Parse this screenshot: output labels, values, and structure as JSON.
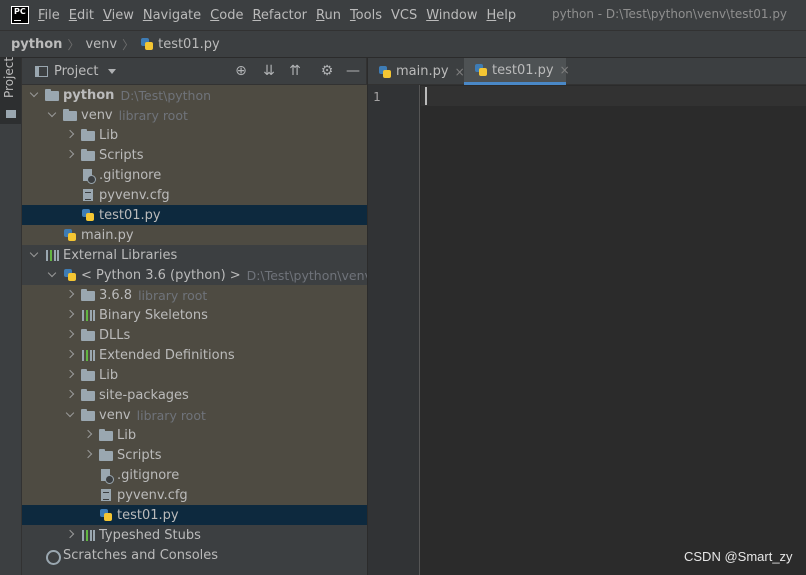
{
  "app": {
    "logo_text": "PC",
    "window_title": "python - D:\\Test\\python\\venv\\test01.py"
  },
  "menu": [
    {
      "mnemonic": "F",
      "rest": "ile"
    },
    {
      "mnemonic": "E",
      "rest": "dit"
    },
    {
      "mnemonic": "V",
      "rest": "iew"
    },
    {
      "mnemonic": "N",
      "rest": "avigate"
    },
    {
      "mnemonic": "C",
      "rest": "ode"
    },
    {
      "mnemonic": "R",
      "rest": "efactor"
    },
    {
      "mnemonic": "R",
      "rest": "un"
    },
    {
      "mnemonic": "T",
      "rest": "ools"
    },
    {
      "mnemonic": "",
      "rest": "VCS"
    },
    {
      "mnemonic": "W",
      "rest": "indow"
    },
    {
      "mnemonic": "H",
      "rest": "elp"
    }
  ],
  "breadcrumb": [
    "python",
    "venv",
    "test01.py"
  ],
  "toolstrip": {
    "project_tab": "Project"
  },
  "project_panel": {
    "title": "Project",
    "icons": [
      "locate-icon",
      "expand-all-icon",
      "collapse-all-icon",
      "gear-icon",
      "minimize-icon"
    ]
  },
  "tree": [
    {
      "label": "python",
      "sub": "D:\\Test\\python",
      "bold": true,
      "arrow": "down",
      "icon": "folder-icon",
      "indent": 0
    },
    {
      "label": "venv",
      "sub": "library root",
      "arrow": "down",
      "icon": "folder-icon",
      "indent": 1
    },
    {
      "label": "Lib",
      "sub": "",
      "arrow": "right",
      "icon": "folder-icon",
      "indent": 2
    },
    {
      "label": "Scripts",
      "sub": "",
      "arrow": "right",
      "icon": "folder-icon",
      "indent": 2
    },
    {
      "label": ".gitignore",
      "sub": "",
      "arrow": "none",
      "icon": "gitignore-icon",
      "indent": 2
    },
    {
      "label": "pyvenv.cfg",
      "sub": "",
      "arrow": "none",
      "icon": "file-icon",
      "indent": 2
    },
    {
      "label": "test01.py",
      "sub": "",
      "arrow": "none",
      "icon": "python-file-icon",
      "indent": 2,
      "selected": true
    },
    {
      "label": "main.py",
      "sub": "",
      "arrow": "none",
      "icon": "python-file-icon",
      "indent": 1
    },
    {
      "label": "External Libraries",
      "sub": "",
      "arrow": "down",
      "icon": "library-icon",
      "indent": 0
    },
    {
      "label": "< Python 3.6 (python) >",
      "sub": "D:\\Test\\python\\venv\\Scr",
      "arrow": "down",
      "icon": "python-file-icon",
      "indent": 1
    },
    {
      "label": "3.6.8",
      "sub": "library root",
      "arrow": "right",
      "icon": "folder-icon",
      "indent": 2
    },
    {
      "label": "Binary Skeletons",
      "sub": "",
      "arrow": "right",
      "icon": "library-icon",
      "indent": 2
    },
    {
      "label": "DLLs",
      "sub": "",
      "arrow": "right",
      "icon": "folder-icon",
      "indent": 2
    },
    {
      "label": "Extended Definitions",
      "sub": "",
      "arrow": "right",
      "icon": "library-icon",
      "indent": 2
    },
    {
      "label": "Lib",
      "sub": "",
      "arrow": "right",
      "icon": "folder-icon",
      "indent": 2
    },
    {
      "label": "site-packages",
      "sub": "",
      "arrow": "right",
      "icon": "folder-icon",
      "indent": 2
    },
    {
      "label": "venv",
      "sub": "library root",
      "arrow": "down",
      "icon": "folder-icon",
      "indent": 2
    },
    {
      "label": "Lib",
      "sub": "",
      "arrow": "right",
      "icon": "folder-icon",
      "indent": 3
    },
    {
      "label": "Scripts",
      "sub": "",
      "arrow": "right",
      "icon": "folder-icon",
      "indent": 3
    },
    {
      "label": ".gitignore",
      "sub": "",
      "arrow": "none",
      "icon": "gitignore-icon",
      "indent": 3
    },
    {
      "label": "pyvenv.cfg",
      "sub": "",
      "arrow": "none",
      "icon": "file-icon",
      "indent": 3
    },
    {
      "label": "test01.py",
      "sub": "",
      "arrow": "none",
      "icon": "python-file-icon",
      "indent": 3,
      "selected": true
    },
    {
      "label": "Typeshed Stubs",
      "sub": "",
      "arrow": "right",
      "icon": "library-icon",
      "indent": 2
    },
    {
      "label": "Scratches and Consoles",
      "sub": "",
      "arrow": "none",
      "icon": "scratches-icon",
      "indent": 0
    }
  ],
  "editor": {
    "tabs": [
      {
        "label": "main.py",
        "close": "×",
        "active": false
      },
      {
        "label": "test01.py",
        "close": "×",
        "active": true
      }
    ],
    "line_numbers": [
      "1"
    ]
  },
  "watermark": "CSDN @Smart_zy",
  "colors": {
    "background": "#2b2b2b",
    "panel": "#3c3f41",
    "selection": "#0d293e",
    "highlight_rows": "#4e4b42",
    "accent": "#4a88c7"
  }
}
